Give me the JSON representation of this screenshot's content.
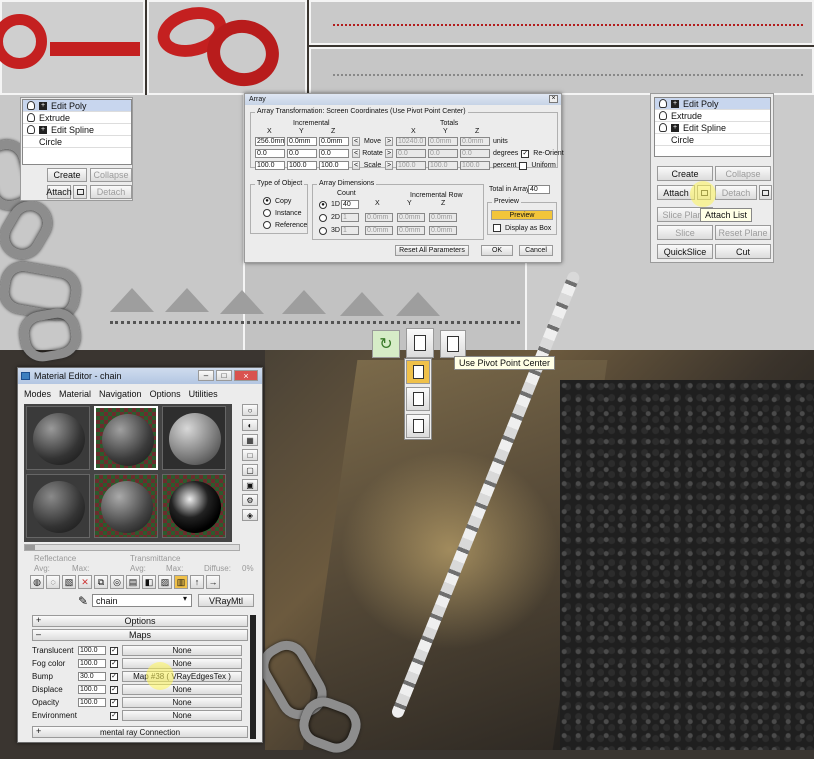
{
  "modifier_stack_left": {
    "items": [
      "Edit Poly",
      "Extrude",
      "Edit Spline",
      "Circle"
    ],
    "buttons": [
      "Create",
      "Collapse",
      "Attach",
      "Detach"
    ]
  },
  "modifier_stack_right": {
    "items": [
      "Edit Poly",
      "Extrude",
      "Edit Spline",
      "Circle"
    ],
    "buttons": {
      "create": "Create",
      "collapse": "Collapse",
      "attach": "Attach",
      "detach": "Detach",
      "slice_plane": "Slice Plane",
      "slice": "Slice",
      "reset_plane": "Reset Plane",
      "quickslice": "QuickSlice",
      "cut": "Cut"
    },
    "tooltip": "Attach List"
  },
  "array_dialog": {
    "title": "Array",
    "transform_group": "Array Transformation: Screen Coordinates (Use Pivot Point Center)",
    "incremental": "Incremental",
    "totals": "Totals",
    "axes": [
      "X",
      "Y",
      "Z"
    ],
    "move": {
      "label": "Move",
      "inc": [
        "256.0mm",
        "0.0mm",
        "0.0mm"
      ],
      "tot": [
        "10240.0",
        "0.0mm",
        "0.0mm"
      ],
      "unit": "units"
    },
    "rotate": {
      "label": "Rotate",
      "inc": [
        "0.0",
        "0.0",
        "0.0"
      ],
      "tot": [
        "0.0",
        "0.0",
        "0.0"
      ],
      "unit": "degrees",
      "reorient": "Re-Orient"
    },
    "scale": {
      "label": "Scale",
      "inc": [
        "100.0",
        "100.0",
        "100.0"
      ],
      "tot": [
        "100.0",
        "100.0",
        "100.0"
      ],
      "unit": "percent",
      "uniform": "Uniform"
    },
    "arrow": "<",
    "arrow_right": ">",
    "type_of_object": {
      "title": "Type of Object",
      "options": [
        "Copy",
        "Instance",
        "Reference"
      ]
    },
    "array_dimensions": {
      "title": "Array Dimensions",
      "count_label": "Count",
      "incremental_row": "Incremental Row",
      "dims": [
        "1D",
        "2D",
        "3D"
      ],
      "count_1d": "40",
      "count_2d": "1",
      "count_3d": "1",
      "row_values": [
        "0.0mm",
        "0.0mm",
        "0.0mm"
      ]
    },
    "total_in_array_label": "Total in Array:",
    "total_in_array": "40",
    "preview_group": "Preview",
    "preview_button": "Preview",
    "display_as_box": "Display as Box",
    "reset_button": "Reset All Parameters",
    "ok_button": "OK",
    "cancel_button": "Cancel"
  },
  "pivot_tooltip": "Use Pivot Point Center",
  "material_editor": {
    "title": "Material Editor - chain",
    "menu": [
      "Modes",
      "Material",
      "Navigation",
      "Options",
      "Utilities"
    ],
    "reflectance": {
      "label": "Reflectance",
      "avg": "Avg:",
      "max": "Max:"
    },
    "transmittance": {
      "label": "Transmittance",
      "avg": "Avg:",
      "max": "Max:",
      "diffuse": "Diffuse:",
      "diffuse_value": "0%"
    },
    "material_name": "chain",
    "material_type": "VRayMtl",
    "options_rollout": "Options",
    "maps_rollout": "Maps",
    "maps": [
      {
        "name": "Translucent",
        "amount": "100.0",
        "map": "None"
      },
      {
        "name": "Fog color",
        "amount": "100.0",
        "map": "None"
      },
      {
        "name": "Bump",
        "amount": "30.0",
        "map": "Map #38  ( VRayEdgesTex )"
      },
      {
        "name": "Displace",
        "amount": "100.0",
        "map": "None"
      },
      {
        "name": "Opacity",
        "amount": "100.0",
        "map": "None"
      },
      {
        "name": "Environment",
        "amount": "",
        "map": "None"
      }
    ],
    "mental_ray": "mental ray Connection"
  },
  "colors": {
    "chain_red": "#c42020",
    "highlight": "#f4e85a",
    "preview_btn": "#f2c53a",
    "render_bg": "#3a3530"
  }
}
